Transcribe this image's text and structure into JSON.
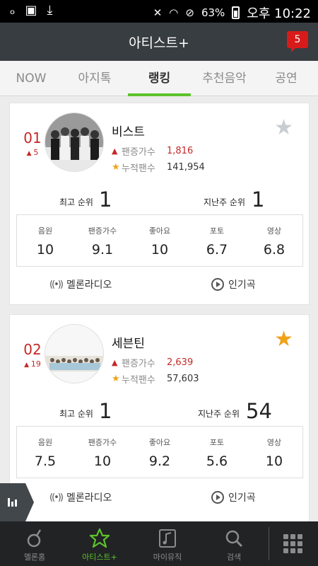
{
  "status_bar": {
    "battery": "63%",
    "time": "오후 10:22"
  },
  "header": {
    "title": "아티스트+",
    "notification_count": "5"
  },
  "tabs": [
    {
      "label": "NOW",
      "active": false
    },
    {
      "label": "아지톡",
      "active": false
    },
    {
      "label": "랭킹",
      "active": true
    },
    {
      "label": "추천음악",
      "active": false
    },
    {
      "label": "공연",
      "active": false
    }
  ],
  "artists": [
    {
      "rank": "01",
      "change": "5",
      "name": "비스트",
      "starred": false,
      "fan_increase_label": "팬증가수",
      "fan_increase": "1,816",
      "total_fans_label": "누적팬수",
      "total_fans": "141,954",
      "best_rank_label": "최고 순위",
      "best_rank": "1",
      "last_week_label": "지난주 순위",
      "last_week": "1",
      "scores": [
        {
          "label": "음원",
          "value": "10"
        },
        {
          "label": "팬증가수",
          "value": "9.1"
        },
        {
          "label": "좋아요",
          "value": "10"
        },
        {
          "label": "포토",
          "value": "6.7"
        },
        {
          "label": "영상",
          "value": "6.8"
        }
      ],
      "radio_label": "멜론라디오",
      "popular_label": "인기곡"
    },
    {
      "rank": "02",
      "change": "19",
      "name": "세븐틴",
      "starred": true,
      "fan_increase_label": "팬증가수",
      "fan_increase": "2,639",
      "total_fans_label": "누적팬수",
      "total_fans": "57,603",
      "best_rank_label": "최고 순위",
      "best_rank": "1",
      "last_week_label": "지난주 순위",
      "last_week": "54",
      "scores": [
        {
          "label": "음원",
          "value": "7.5"
        },
        {
          "label": "팬증가수",
          "value": "10"
        },
        {
          "label": "좋아요",
          "value": "9.2"
        },
        {
          "label": "포토",
          "value": "5.6"
        },
        {
          "label": "영상",
          "value": "10"
        }
      ],
      "radio_label": "멜론라디오",
      "popular_label": "인기곡"
    }
  ],
  "bottom_nav": [
    {
      "label": "멜론홈",
      "icon": "melon-home-icon",
      "active": false
    },
    {
      "label": "아티스트+",
      "icon": "star-outline-icon",
      "active": true
    },
    {
      "label": "마이뮤직",
      "icon": "my-music-icon",
      "active": false
    },
    {
      "label": "검색",
      "icon": "search-icon",
      "active": false
    }
  ],
  "colors": {
    "accent": "#5dc22a",
    "rank_red": "#c62828",
    "star_gold": "#f0a21a",
    "header": "#383d41"
  }
}
